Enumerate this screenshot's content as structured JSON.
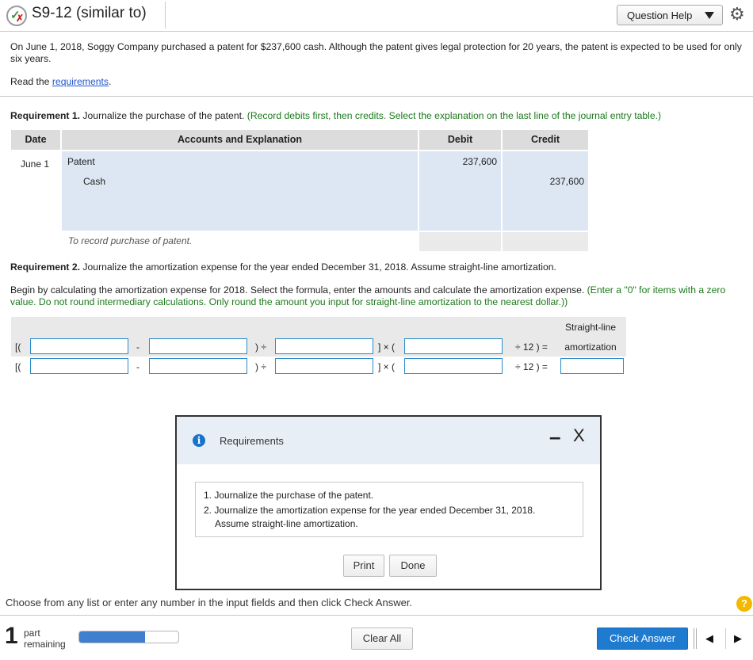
{
  "header": {
    "title": "S9-12 (similar to)",
    "help_label": "Question Help",
    "status_icon": "partial-correct-icon",
    "settings_icon": "gear-icon"
  },
  "problem": {
    "text": "On June 1, 2018, Soggy Company purchased a patent for $237,600 cash. Although the patent gives legal protection for 20 years, the patent is expected to be used for only six years.",
    "read_prefix": "Read the ",
    "read_link": "requirements",
    "read_suffix": "."
  },
  "req1": {
    "title": "Requirement 1.",
    "text": " Journalize the purchase of the patent.",
    "hint": "(Record debits first, then credits. Select the explanation on the last line of the journal entry table.)"
  },
  "journal": {
    "headers": {
      "date": "Date",
      "accounts": "Accounts and Explanation",
      "debit": "Debit",
      "credit": "Credit"
    },
    "date": "June 1",
    "rows": [
      {
        "account": "Patent",
        "debit": "237,600",
        "credit": ""
      },
      {
        "account": "Cash",
        "debit": "",
        "credit": "237,600"
      }
    ],
    "explanation": "To record purchase of patent."
  },
  "req2": {
    "title": "Requirement 2.",
    "text": " Journalize the amortization expense for the year ended December 31, 2018. Assume straight-line amortization.",
    "intro": "Begin by calculating the amortization expense for 2018. Select the formula, enter the amounts and calculate the amortization expense.",
    "hint": "(Enter a \"0\" for items with a zero value. Do not round intermediary calculations. Only round the amount you input for straight-line amortization to the nearest dollar.))"
  },
  "formula": {
    "open": "[(",
    "minus": "-",
    "div_close": ") ÷",
    "times_open": "] × (",
    "div12_eq": "÷ 12 ) =",
    "result_label_1": "Straight-line",
    "result_label_2": "amortization"
  },
  "modal": {
    "title": "Requirements",
    "item1": "1. Journalize the purchase of the patent.",
    "item2a": "2. Journalize the amortization expense for the year ended December 31, 2018.",
    "item2b": "Assume straight-line amortization.",
    "print": "Print",
    "done": "Done",
    "minimize": "–",
    "close": "X"
  },
  "footer": {
    "instruction": "Choose from any list or enter any number in the input fields and then click Check Answer.",
    "parts_count": "1",
    "parts_line1": "part",
    "parts_line2": "remaining",
    "progress_fraction": 0.66,
    "clear_all": "Clear All",
    "check_answer": "Check Answer",
    "help": "?",
    "prev": "◀",
    "next": "▶"
  }
}
